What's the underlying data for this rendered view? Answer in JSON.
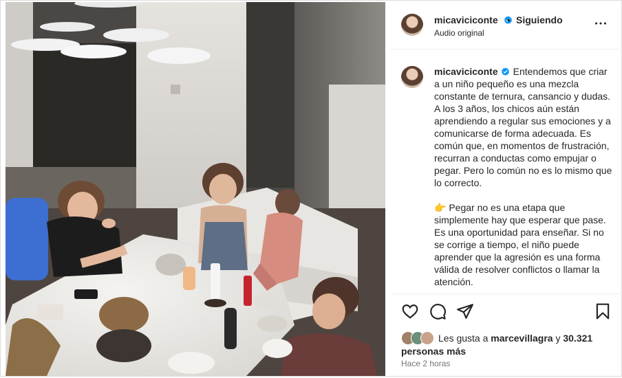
{
  "header": {
    "username": "micaviciconte",
    "separator": "•",
    "follow_label": "Siguiendo",
    "audio_label": "Audio original"
  },
  "caption": {
    "username": "micaviciconte",
    "text": "Entendemos que criar a un niño pequeño es una mezcla constante de ternura, cansancio y dudas. A los 3 años, los chicos aún están aprendiendo a regular sus emociones y a comunicarse de forma adecuada. Es común que, en momentos de frustración, recurran a conductas como empujar o pegar. Pero lo común no es lo mismo que lo correcto.\n\n👉 Pegar no es una etapa que simplemente hay que esperar que pase. Es una oportunidad para enseñar. Si no se corrige a tiempo, el niño puede aprender que la agresión es una forma válida de resolver conflictos o llamar la atención."
  },
  "likes": {
    "prefix": "Les gusta a",
    "first_liker": "marcevillagra",
    "conjunction": "y",
    "others": "30.321 personas más"
  },
  "timestamp": "Hace 2 horas",
  "icons": [
    "verified-icon",
    "more-options-icon",
    "heart-icon",
    "comment-icon",
    "share-icon",
    "bookmark-icon"
  ],
  "colors": {
    "verified": "#0095f6",
    "text": "#262626",
    "muted": "#737373",
    "border": "#dbdbdb"
  }
}
